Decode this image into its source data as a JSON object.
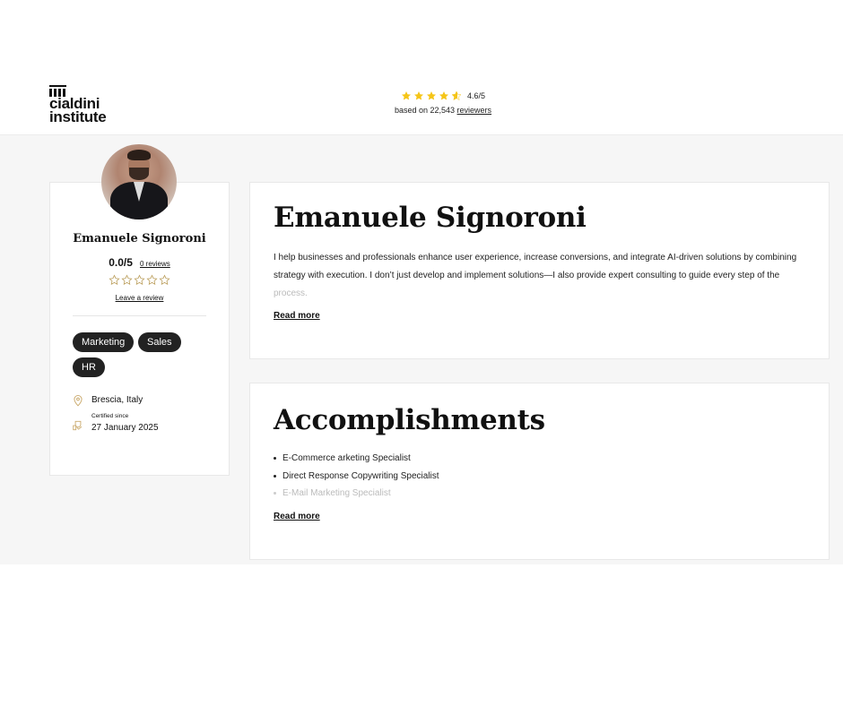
{
  "brand": {
    "logo_line1": "cialdini",
    "logo_line2": "institute"
  },
  "site_rating": {
    "score": "4.6/5",
    "based_prefix": "based on 22,543",
    "reviewers_link": "reviewers",
    "stars_value": 4.6,
    "star_color": "#f5c518"
  },
  "profile": {
    "name": "Emanuele Signoroni",
    "score": "0.0/5",
    "reviews_link": "0 reviews",
    "leave_review": "Leave a review",
    "tags": [
      "Marketing",
      "Sales",
      "HR"
    ],
    "location": "Brescia, Italy",
    "certified_label": "Certified since",
    "certified_date": "27 January 2025"
  },
  "about": {
    "title": "Emanuele Signoroni",
    "line1": "I help businesses and professionals enhance user experience, increase conversions, and integrate AI-driven solutions by combining",
    "line2": "strategy with execution. I don’t just develop and implement solutions—I also provide expert consulting to guide every step of the",
    "line3": "process.",
    "read_more": "Read more"
  },
  "accomplishments": {
    "title": "Accomplishments",
    "items": [
      "E-Commerce arketing Specialist",
      "Direct Response Copywriting Specialist",
      "E-Mail Marketing Specialist"
    ],
    "read_more": "Read more"
  }
}
